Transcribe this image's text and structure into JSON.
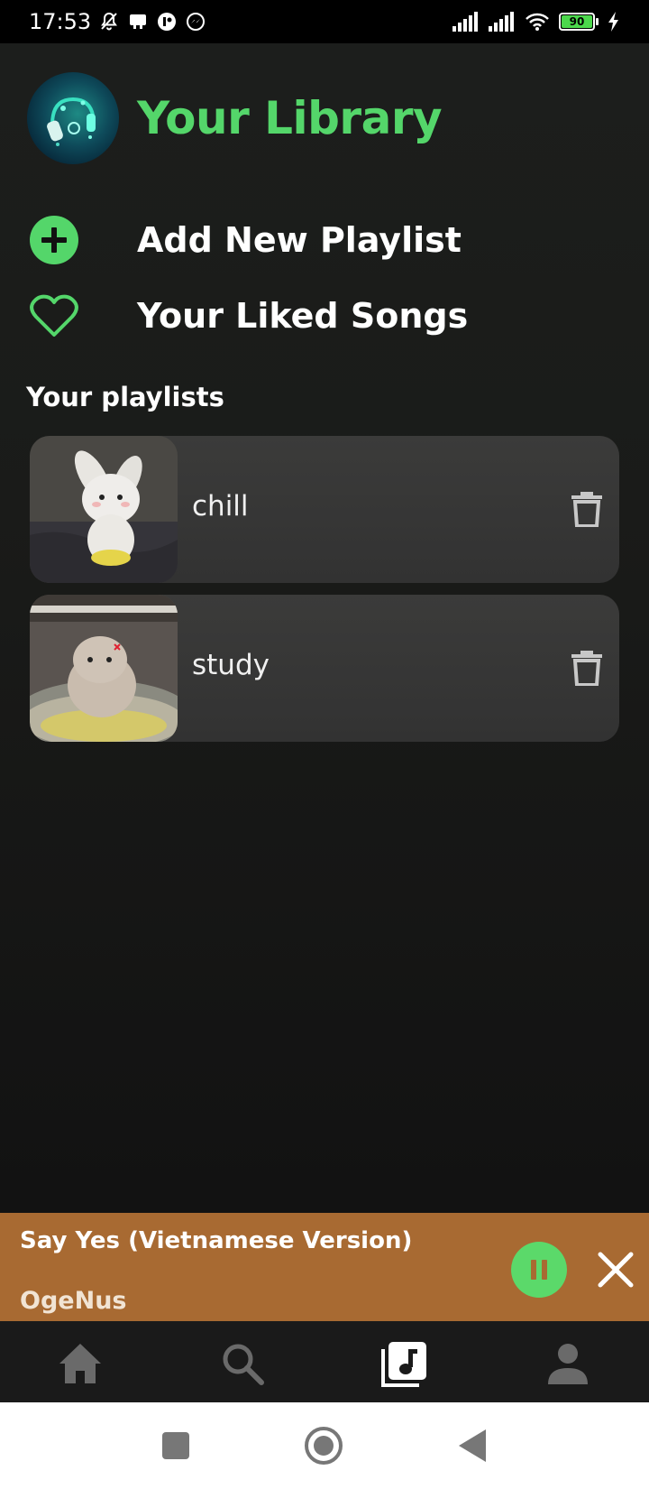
{
  "status_bar": {
    "time": "17:53",
    "battery": "90",
    "left_icons": [
      "muted-bell-icon",
      "message-icon",
      "app-notification-icon",
      "messenger-icon"
    ],
    "right_icons": [
      "signal-icon",
      "signal-icon",
      "wifi-icon",
      "battery-icon",
      "charging-icon"
    ]
  },
  "header": {
    "title": "Your Library"
  },
  "actions": {
    "add_playlist": "Add New Playlist",
    "liked_songs": "Your Liked Songs"
  },
  "playlists_section": {
    "title": "Your playlists",
    "items": [
      {
        "name": "chill",
        "thumbnail": "plush-bunny-photo"
      },
      {
        "name": "study",
        "thumbnail": "kitten-photo"
      }
    ]
  },
  "mini_player": {
    "title": "Say Yes (Vietnamese Version)",
    "artist": "OgeNus",
    "state": "playing"
  },
  "bottom_nav": {
    "items": [
      "home-icon",
      "search-icon",
      "library-icon",
      "profile-icon"
    ],
    "active": "library-icon"
  },
  "colors": {
    "accent_green": "#54d66a",
    "mini_player_bg": "#a86a32",
    "background": "#1a1b19",
    "card_bg": "#383838"
  }
}
